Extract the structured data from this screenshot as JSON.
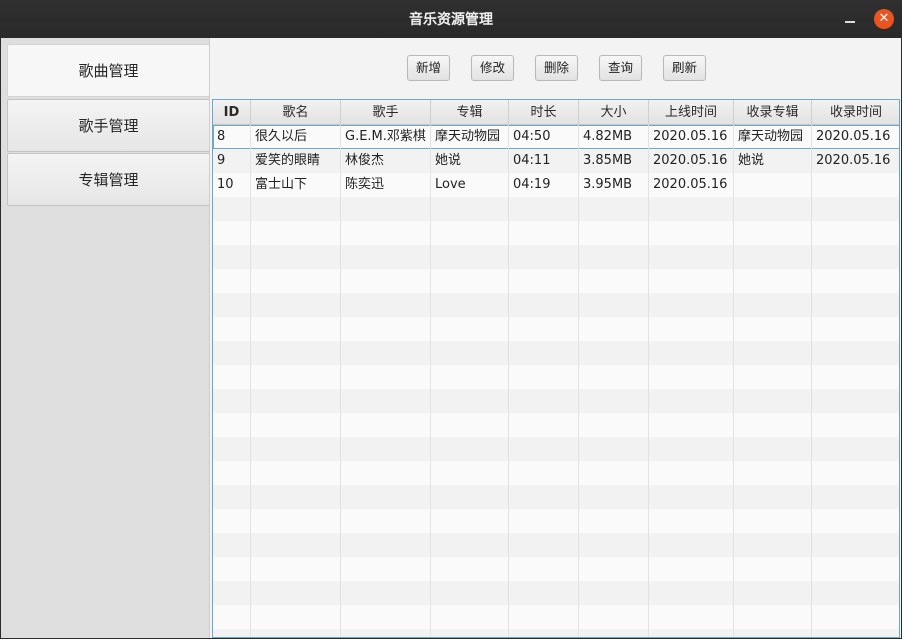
{
  "window": {
    "title": "音乐资源管理",
    "close_label": "✕"
  },
  "sidebar": {
    "items": [
      {
        "label": "歌曲管理"
      },
      {
        "label": "歌手管理"
      },
      {
        "label": "专辑管理"
      }
    ]
  },
  "toolbar": {
    "add_label": "新增",
    "edit_label": "修改",
    "delete_label": "删除",
    "query_label": "查询",
    "refresh_label": "刷新"
  },
  "table": {
    "columns": [
      "ID",
      "歌名",
      "歌手",
      "专辑",
      "时长",
      "大小",
      "上线时间",
      "收录专辑",
      "收录时间"
    ],
    "rows": [
      [
        "8",
        "很久以后",
        "G.E.M.邓紫棋",
        "摩天动物园",
        "04:50",
        "4.82MB",
        "2020.05.16",
        "摩天动物园",
        "2020.05.16"
      ],
      [
        "9",
        "爱笑的眼睛",
        "林俊杰",
        "她说",
        "04:11",
        "3.85MB",
        "2020.05.16",
        "她说",
        "2020.05.16"
      ],
      [
        "10",
        "富士山下",
        "陈奕迅",
        "Love",
        "04:19",
        "3.95MB",
        "2020.05.16",
        "",
        ""
      ]
    ],
    "selected_row": 0
  }
}
